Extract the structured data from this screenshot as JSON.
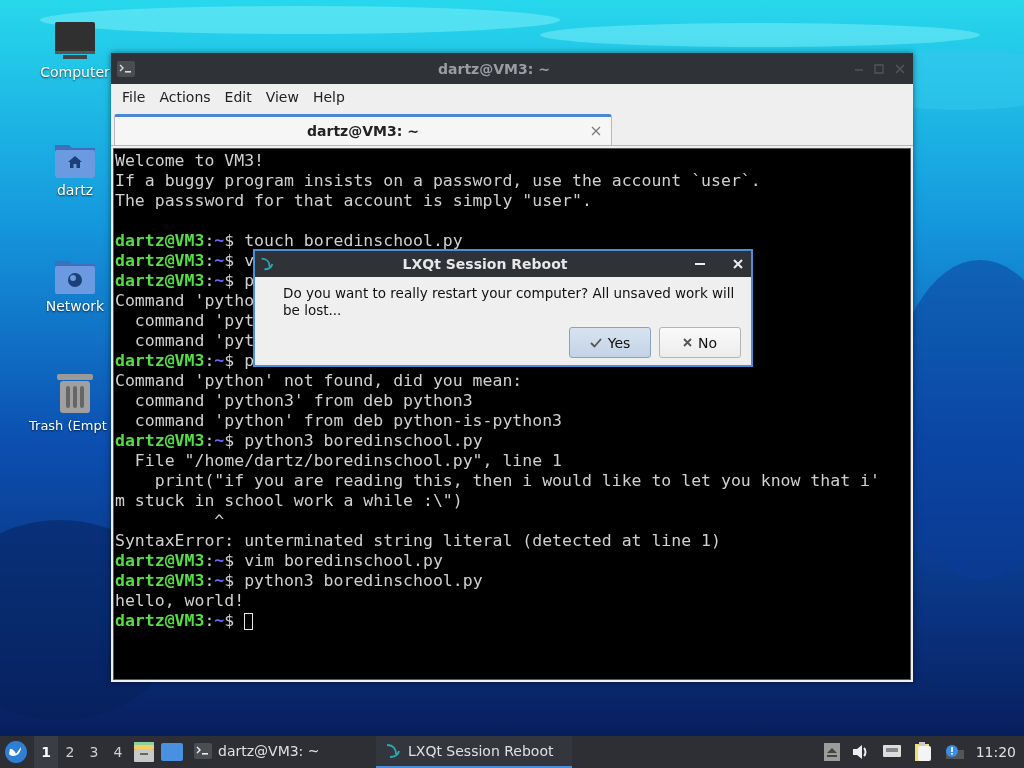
{
  "desktop_icons": [
    {
      "kind": "computer",
      "label": "Computer"
    },
    {
      "kind": "home",
      "label": "dartz"
    },
    {
      "kind": "network",
      "label": "Network"
    },
    {
      "kind": "trash",
      "label": "Trash (Empt"
    }
  ],
  "terminal": {
    "title": "dartz@VM3: ~",
    "menu": [
      "File",
      "Actions",
      "Edit",
      "View",
      "Help"
    ],
    "tabs": [
      {
        "label": "dartz@VM3: ~",
        "selected": true
      }
    ],
    "lines": [
      {
        "kind": "text",
        "text": "Welcome to VM3!"
      },
      {
        "kind": "text",
        "text": "If a buggy program insists on a password, use the account `user`."
      },
      {
        "kind": "text",
        "text": "The passsword for that account is simply \"user\"."
      },
      {
        "kind": "blank"
      },
      {
        "kind": "prompt",
        "user": "dartz@VM3",
        "sep": ":",
        "path": "~",
        "command": "$ touch boredinschool.py",
        "cursor": false
      },
      {
        "kind": "prompt",
        "user": "dartz@VM3",
        "sep": ":",
        "path": "~",
        "command": "$ v",
        "cursor": false
      },
      {
        "kind": "prompt",
        "user": "dartz@VM3",
        "sep": ":",
        "path": "~",
        "command": "$ p",
        "cursor": false
      },
      {
        "kind": "text",
        "text": "Command 'pytho"
      },
      {
        "kind": "text",
        "text": "  command 'pyt"
      },
      {
        "kind": "text",
        "text": "  command 'pyt"
      },
      {
        "kind": "prompt",
        "user": "dartz@VM3",
        "sep": ":",
        "path": "~",
        "command": "$ p",
        "cursor": false
      },
      {
        "kind": "text",
        "text": "Command 'python' not found, did you mean:"
      },
      {
        "kind": "text",
        "text": "  command 'python3' from deb python3"
      },
      {
        "kind": "text",
        "text": "  command 'python' from deb python-is-python3"
      },
      {
        "kind": "prompt",
        "user": "dartz@VM3",
        "sep": ":",
        "path": "~",
        "command": "$ python3 boredinschool.py",
        "cursor": false
      },
      {
        "kind": "text",
        "text": "  File \"/home/dartz/boredinschool.py\", line 1"
      },
      {
        "kind": "text",
        "text": "    print(\"if you are reading this, then i would like to let you know that i'"
      },
      {
        "kind": "text",
        "text": "m stuck in school work a while :\\\")"
      },
      {
        "kind": "text",
        "text": "          ^"
      },
      {
        "kind": "text",
        "text": "SyntaxError: unterminated string literal (detected at line 1)"
      },
      {
        "kind": "prompt",
        "user": "dartz@VM3",
        "sep": ":",
        "path": "~",
        "command": "$ vim boredinschool.py",
        "cursor": false
      },
      {
        "kind": "prompt",
        "user": "dartz@VM3",
        "sep": ":",
        "path": "~",
        "command": "$ python3 boredinschool.py",
        "cursor": false
      },
      {
        "kind": "text",
        "text": "hello, world!"
      },
      {
        "kind": "prompt",
        "user": "dartz@VM3",
        "sep": ":",
        "path": "~",
        "command": "$ ",
        "cursor": true
      }
    ]
  },
  "dialog": {
    "title": "LXQt Session Reboot",
    "message": "Do you want to really restart your computer? All unsaved work will be lost...",
    "buttons": [
      {
        "kind": "confirm",
        "label": "Yes",
        "selected": true
      },
      {
        "kind": "cancel",
        "label": "No",
        "selected": false
      }
    ]
  },
  "taskbar": {
    "workspaces": [
      {
        "label": "1",
        "selected": true
      },
      {
        "label": "2",
        "selected": false
      },
      {
        "label": "3",
        "selected": false
      },
      {
        "label": "4",
        "selected": false
      }
    ],
    "tasks": [
      {
        "kind": "terminal",
        "label": "dartz@VM3: ~",
        "selected": false
      },
      {
        "kind": "dialog",
        "label": "LXQt Session Reboot",
        "selected": true
      }
    ],
    "clock": "11:20"
  }
}
